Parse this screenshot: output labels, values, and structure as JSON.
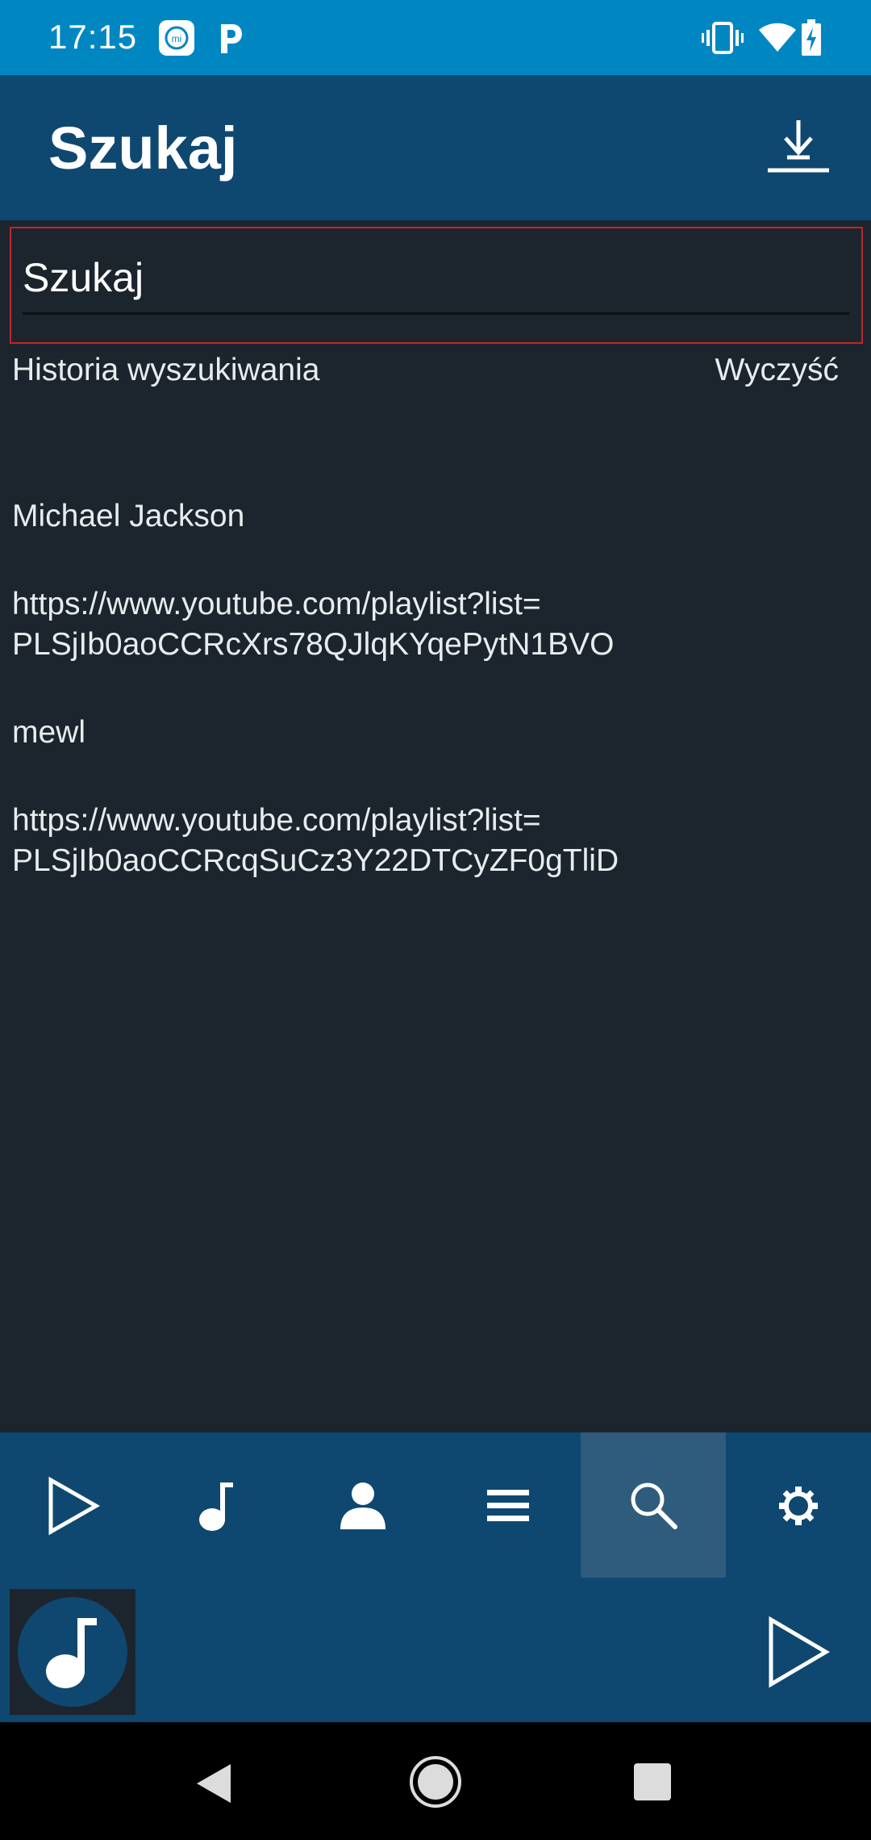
{
  "status_bar": {
    "time": "17:15",
    "icons": [
      "mi-app-icon",
      "p-app-icon",
      "vibrate-icon",
      "wifi-icon",
      "battery-charging-icon"
    ]
  },
  "app_bar": {
    "title": "Szukaj",
    "download_icon": "download-icon"
  },
  "search": {
    "placeholder": "Szukaj",
    "value": ""
  },
  "history": {
    "header": "Historia wyszukiwania",
    "clear_label": "Wyczyść",
    "items": [
      {
        "line1": "Michael Jackson",
        "line2": ""
      },
      {
        "line1": "https://www.youtube.com/playlist?list=",
        "line2": "PLSjIb0aoCCRcXrs78QJlqKYqePytN1BVO"
      },
      {
        "line1": "mewl",
        "line2": ""
      },
      {
        "line1": "https://www.youtube.com/playlist?list=",
        "line2": "PLSjIb0aoCCRcqSuCz3Y22DTCyZF0gTliD"
      }
    ]
  },
  "bottom_nav": {
    "items": [
      "play-icon",
      "music-note-icon",
      "person-icon",
      "menu-icon",
      "search-icon",
      "settings-icon"
    ],
    "active": "search-icon"
  },
  "player": {
    "album_icon": "music-note-icon",
    "play_icon": "play-icon"
  },
  "colors": {
    "status_bar": "#0087c2",
    "app_bar": "#0e4870",
    "background": "#1c252d",
    "highlight_border": "#c0262c",
    "nav_active": "#2f5b7d"
  }
}
